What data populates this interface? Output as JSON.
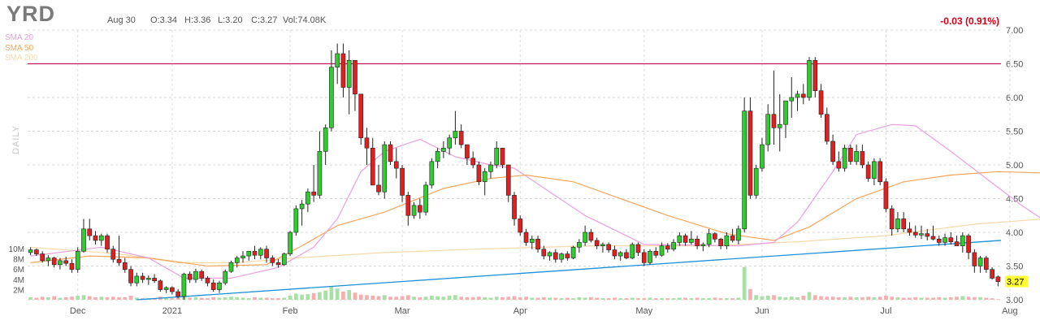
{
  "header": {
    "ticker": "YRD",
    "date": "Aug 30",
    "open": "O:3.34",
    "high": "H:3.36",
    "low": "L:3.20",
    "close": "C:3.27",
    "volume": "Vol:74.08K",
    "change": "-0.03 (0.91%)",
    "panel_label": "DAILY"
  },
  "legend": [
    {
      "name": "SMA 20",
      "color": "#e9a0e0"
    },
    {
      "name": "SMA 50",
      "color": "#f5a55a"
    },
    {
      "name": "SMA 200",
      "color": "#f7d9a8"
    }
  ],
  "colors": {
    "up": "#2ecc2e",
    "down": "#e02020",
    "volume": "#a8e0a8",
    "volume_down": "#f4b0b0",
    "resistance": "#c2185b",
    "trendline": "#1e90d8",
    "last_price_bg": "#ffff33"
  },
  "chart_data": {
    "type": "candlestick",
    "y_ticks": [
      "7.00",
      "6.50",
      "6.00",
      "5.50",
      "5.00",
      "4.50",
      "4.00",
      "3.50",
      "3.00"
    ],
    "ylim": [
      3.0,
      7.0
    ],
    "x_ticks": [
      "Dec",
      "2021",
      "Feb",
      "Mar",
      "Apr",
      "May",
      "Jun",
      "Jul",
      "Aug"
    ],
    "volume_ticks": [
      "10M",
      "8M",
      "6M",
      "4M",
      "2M"
    ],
    "last_price": "3.27",
    "resistance_level": 6.5,
    "trendline": {
      "start": 3.0,
      "end": 3.88
    },
    "ohlc": [
      [
        3.7,
        3.78,
        3.66,
        3.74
      ],
      [
        3.74,
        3.76,
        3.65,
        3.68
      ],
      [
        3.68,
        3.72,
        3.55,
        3.58
      ],
      [
        3.58,
        3.66,
        3.5,
        3.62
      ],
      [
        3.62,
        3.64,
        3.48,
        3.52
      ],
      [
        3.52,
        3.62,
        3.45,
        3.58
      ],
      [
        3.58,
        3.64,
        3.5,
        3.54
      ],
      [
        3.54,
        3.6,
        3.4,
        3.45
      ],
      [
        3.45,
        3.78,
        3.4,
        3.72
      ],
      [
        3.72,
        4.2,
        3.7,
        4.05
      ],
      [
        4.05,
        4.2,
        3.88,
        3.95
      ],
      [
        3.95,
        4.02,
        3.82,
        3.88
      ],
      [
        3.88,
        3.98,
        3.8,
        3.95
      ],
      [
        3.95,
        3.98,
        3.7,
        3.75
      ],
      [
        3.75,
        3.8,
        3.55,
        3.6
      ],
      [
        3.6,
        3.95,
        3.5,
        3.55
      ],
      [
        3.55,
        3.62,
        3.4,
        3.45
      ],
      [
        3.45,
        3.5,
        3.2,
        3.25
      ],
      [
        3.25,
        3.4,
        3.2,
        3.35
      ],
      [
        3.35,
        3.4,
        3.25,
        3.3
      ],
      [
        3.3,
        3.36,
        3.22,
        3.32
      ],
      [
        3.32,
        3.38,
        3.25,
        3.28
      ],
      [
        3.28,
        3.3,
        3.12,
        3.15
      ],
      [
        3.15,
        3.2,
        3.1,
        3.18
      ],
      [
        3.18,
        3.2,
        3.08,
        3.12
      ],
      [
        3.12,
        3.16,
        3.02,
        3.05
      ],
      [
        3.05,
        3.4,
        3.0,
        3.38
      ],
      [
        3.38,
        3.42,
        3.25,
        3.3
      ],
      [
        3.3,
        3.46,
        3.25,
        3.42
      ],
      [
        3.42,
        3.45,
        3.28,
        3.32
      ],
      [
        3.32,
        3.35,
        3.2,
        3.25
      ],
      [
        3.25,
        3.3,
        3.12,
        3.15
      ],
      [
        3.15,
        3.28,
        3.1,
        3.25
      ],
      [
        3.25,
        3.45,
        3.22,
        3.42
      ],
      [
        3.42,
        3.58,
        3.4,
        3.55
      ],
      [
        3.55,
        3.65,
        3.48,
        3.62
      ],
      [
        3.62,
        3.72,
        3.55,
        3.65
      ],
      [
        3.65,
        3.7,
        3.58,
        3.72
      ],
      [
        3.72,
        3.8,
        3.6,
        3.66
      ],
      [
        3.66,
        3.78,
        3.6,
        3.75
      ],
      [
        3.75,
        3.8,
        3.55,
        3.62
      ],
      [
        3.62,
        3.66,
        3.5,
        3.55
      ],
      [
        3.55,
        3.6,
        3.48,
        3.52
      ],
      [
        3.52,
        3.7,
        3.5,
        3.68
      ],
      [
        3.68,
        4.02,
        3.65,
        4.0
      ],
      [
        4.0,
        4.4,
        3.95,
        4.35
      ],
      [
        4.35,
        4.48,
        4.1,
        4.42
      ],
      [
        4.42,
        4.65,
        4.3,
        4.6
      ],
      [
        4.6,
        5.0,
        4.45,
        4.55
      ],
      [
        4.55,
        5.5,
        4.5,
        5.2
      ],
      [
        5.2,
        5.6,
        5.0,
        5.55
      ],
      [
        5.55,
        6.7,
        5.5,
        6.45
      ],
      [
        6.45,
        6.8,
        6.2,
        6.65
      ],
      [
        6.65,
        6.8,
        6.0,
        6.15
      ],
      [
        6.15,
        6.7,
        5.75,
        6.55
      ],
      [
        6.55,
        6.55,
        5.8,
        6.05
      ],
      [
        6.05,
        5.6,
        5.3,
        5.4
      ],
      [
        5.4,
        5.55,
        5.0,
        5.25
      ],
      [
        5.25,
        5.4,
        4.85,
        4.7
      ],
      [
        4.7,
        5.0,
        4.55,
        4.6
      ],
      [
        4.6,
        5.35,
        4.5,
        5.3
      ],
      [
        5.3,
        5.35,
        5.0,
        5.05
      ],
      [
        5.05,
        5.25,
        4.8,
        4.95
      ],
      [
        4.95,
        5.0,
        4.45,
        4.55
      ],
      [
        4.55,
        4.6,
        4.1,
        4.25
      ],
      [
        4.25,
        4.45,
        4.2,
        4.4
      ],
      [
        4.4,
        4.5,
        4.2,
        4.3
      ],
      [
        4.3,
        4.75,
        4.25,
        4.7
      ],
      [
        4.7,
        5.1,
        4.65,
        5.05
      ],
      [
        5.05,
        5.25,
        4.95,
        5.2
      ],
      [
        5.2,
        5.35,
        5.1,
        5.25
      ],
      [
        5.25,
        5.45,
        5.15,
        5.4
      ],
      [
        5.4,
        5.8,
        5.3,
        5.5
      ],
      [
        5.5,
        5.6,
        5.25,
        5.3
      ],
      [
        5.3,
        5.3,
        5.0,
        5.1
      ],
      [
        5.1,
        5.2,
        4.95,
        5.0
      ],
      [
        5.0,
        5.05,
        4.7,
        4.75
      ],
      [
        4.75,
        4.95,
        4.55,
        4.9
      ],
      [
        4.9,
        5.05,
        4.8,
        5.0
      ],
      [
        5.0,
        5.35,
        4.95,
        5.25
      ],
      [
        5.25,
        5.2,
        4.95,
        5.0
      ],
      [
        5.0,
        5.0,
        4.45,
        4.55
      ],
      [
        4.55,
        4.6,
        4.1,
        4.2
      ],
      [
        4.2,
        4.25,
        3.95,
        4.0
      ],
      [
        4.0,
        4.05,
        3.8,
        3.85
      ],
      [
        3.85,
        3.95,
        3.75,
        3.9
      ],
      [
        3.9,
        3.95,
        3.7,
        3.75
      ],
      [
        3.75,
        3.8,
        3.6,
        3.65
      ],
      [
        3.65,
        3.72,
        3.58,
        3.7
      ],
      [
        3.7,
        3.75,
        3.55,
        3.6
      ],
      [
        3.6,
        3.7,
        3.55,
        3.68
      ],
      [
        3.68,
        3.72,
        3.58,
        3.62
      ],
      [
        3.62,
        3.8,
        3.6,
        3.78
      ],
      [
        3.78,
        3.9,
        3.7,
        3.85
      ],
      [
        3.85,
        4.1,
        3.8,
        4.0
      ],
      [
        4.0,
        4.05,
        3.85,
        3.88
      ],
      [
        3.88,
        3.92,
        3.75,
        3.8
      ],
      [
        3.8,
        3.85,
        3.7,
        3.82
      ],
      [
        3.82,
        3.85,
        3.7,
        3.74
      ],
      [
        3.74,
        3.8,
        3.6,
        3.65
      ],
      [
        3.65,
        3.72,
        3.58,
        3.7
      ],
      [
        3.7,
        3.75,
        3.6,
        3.62
      ],
      [
        3.62,
        3.85,
        3.6,
        3.82
      ],
      [
        3.82,
        3.85,
        3.65,
        3.7
      ],
      [
        3.7,
        3.75,
        3.5,
        3.55
      ],
      [
        3.55,
        3.75,
        3.52,
        3.72
      ],
      [
        3.72,
        3.78,
        3.62,
        3.66
      ],
      [
        3.66,
        3.85,
        3.64,
        3.8
      ],
      [
        3.8,
        3.84,
        3.7,
        3.75
      ],
      [
        3.75,
        3.9,
        3.72,
        3.85
      ],
      [
        3.85,
        4.0,
        3.8,
        3.95
      ],
      [
        3.95,
        3.98,
        3.8,
        3.85
      ],
      [
        3.85,
        4.02,
        3.82,
        3.9
      ],
      [
        3.9,
        3.95,
        3.75,
        3.8
      ],
      [
        3.8,
        3.85,
        3.72,
        3.82
      ],
      [
        3.82,
        4.05,
        3.78,
        3.98
      ],
      [
        3.98,
        4.0,
        3.85,
        3.9
      ],
      [
        3.9,
        3.92,
        3.75,
        3.8
      ],
      [
        3.8,
        4.0,
        3.75,
        3.95
      ],
      [
        3.95,
        4.05,
        3.85,
        3.88
      ],
      [
        3.88,
        4.1,
        3.82,
        4.05
      ],
      [
        4.05,
        6.0,
        4.0,
        5.8
      ],
      [
        5.8,
        6.0,
        4.5,
        4.55
      ],
      [
        4.55,
        5.0,
        4.5,
        4.95
      ],
      [
        4.95,
        5.4,
        4.9,
        5.3
      ],
      [
        5.3,
        5.9,
        5.2,
        5.75
      ],
      [
        5.75,
        6.4,
        5.3,
        5.55
      ],
      [
        5.55,
        6.05,
        5.2,
        5.6
      ],
      [
        5.6,
        5.7,
        5.4,
        5.95
      ],
      [
        5.95,
        6.3,
        5.7,
        6.0
      ],
      [
        6.0,
        6.1,
        5.8,
        6.05
      ],
      [
        6.05,
        6.2,
        5.9,
        6.0
      ],
      [
        6.0,
        6.6,
        5.95,
        6.55
      ],
      [
        6.55,
        6.6,
        6.0,
        6.1
      ],
      [
        6.1,
        6.2,
        5.7,
        5.75
      ],
      [
        5.75,
        5.85,
        5.3,
        5.35
      ],
      [
        5.35,
        5.45,
        5.0,
        5.05
      ],
      [
        5.05,
        5.2,
        4.9,
        4.95
      ],
      [
        4.95,
        5.3,
        4.9,
        5.25
      ],
      [
        5.25,
        5.3,
        5.0,
        5.05
      ],
      [
        5.05,
        5.3,
        5.0,
        5.2
      ],
      [
        5.2,
        5.3,
        4.95,
        5.0
      ],
      [
        5.0,
        5.05,
        4.75,
        4.8
      ],
      [
        4.8,
        5.1,
        4.7,
        5.05
      ],
      [
        5.05,
        5.1,
        4.7,
        4.75
      ],
      [
        4.75,
        4.8,
        4.3,
        4.35
      ],
      [
        4.35,
        4.4,
        3.95,
        4.05
      ],
      [
        4.05,
        4.3,
        4.0,
        4.2
      ],
      [
        4.2,
        4.3,
        4.0,
        4.05
      ],
      [
        4.05,
        4.15,
        3.95,
        4.0
      ],
      [
        4.0,
        4.1,
        3.92,
        3.96
      ],
      [
        3.96,
        4.1,
        3.9,
        3.98
      ],
      [
        3.98,
        4.05,
        3.88,
        3.94
      ],
      [
        3.94,
        4.1,
        3.88,
        3.9
      ],
      [
        3.9,
        3.95,
        3.8,
        3.85
      ],
      [
        3.85,
        3.98,
        3.8,
        3.92
      ],
      [
        3.92,
        4.0,
        3.82,
        3.86
      ],
      [
        3.86,
        3.95,
        3.8,
        3.8
      ],
      [
        3.8,
        4.0,
        3.7,
        3.95
      ],
      [
        3.95,
        3.98,
        3.6,
        3.7
      ],
      [
        3.7,
        3.75,
        3.4,
        3.5
      ],
      [
        3.5,
        3.65,
        3.4,
        3.62
      ],
      [
        3.62,
        3.65,
        3.4,
        3.45
      ],
      [
        3.45,
        3.48,
        3.3,
        3.32
      ],
      [
        3.34,
        3.36,
        3.2,
        3.27
      ]
    ],
    "volume_millions": [
      0.5,
      0.4,
      0.6,
      0.5,
      0.7,
      0.4,
      0.5,
      0.6,
      0.8,
      0.9,
      0.7,
      0.5,
      0.6,
      0.5,
      0.6,
      0.5,
      0.5,
      0.8,
      0.4,
      0.3,
      0.3,
      0.3,
      0.6,
      0.4,
      0.3,
      0.7,
      0.6,
      0.4,
      0.5,
      0.4,
      0.3,
      0.5,
      0.4,
      0.5,
      0.6,
      0.5,
      0.4,
      0.3,
      0.5,
      0.4,
      0.4,
      0.3,
      0.3,
      0.4,
      0.8,
      1.2,
      1.0,
      1.1,
      1.3,
      1.5,
      1.8,
      2.6,
      2.2,
      1.6,
      1.9,
      1.4,
      1.0,
      0.9,
      0.8,
      0.7,
      0.9,
      0.6,
      0.6,
      0.7,
      0.9,
      0.6,
      0.5,
      0.6,
      0.8,
      0.7,
      0.6,
      0.8,
      0.9,
      0.6,
      0.5,
      0.5,
      0.6,
      0.5,
      0.4,
      0.6,
      0.5,
      0.6,
      0.7,
      0.5,
      0.6,
      0.4,
      0.4,
      0.5,
      0.4,
      0.4,
      0.3,
      0.4,
      0.3,
      0.5,
      0.4,
      0.5,
      0.4,
      0.3,
      0.3,
      0.4,
      0.3,
      0.3,
      0.4,
      0.3,
      0.3,
      0.4,
      0.3,
      0.3,
      0.3,
      0.3,
      0.4,
      0.4,
      0.3,
      0.4,
      0.3,
      0.3,
      0.4,
      0.3,
      0.3,
      0.3,
      0.4,
      6.4,
      2.1,
      0.9,
      0.7,
      0.8,
      0.9,
      0.6,
      0.5,
      0.6,
      0.5,
      0.8,
      1.5,
      0.9,
      0.7,
      0.6,
      0.6,
      0.5,
      0.5,
      0.6,
      0.5,
      0.5,
      0.6,
      0.5,
      0.6,
      0.8,
      0.6,
      0.5,
      0.4,
      0.4,
      0.5,
      0.4,
      0.4,
      0.4,
      0.5,
      0.4,
      0.5,
      0.6,
      0.7,
      0.6,
      0.5,
      0.5,
      0.4,
      0.3,
      0.1
    ],
    "sma20": [
      [
        0,
        3.65
      ],
      [
        12,
        3.78
      ],
      [
        20,
        3.62
      ],
      [
        26,
        3.32
      ],
      [
        34,
        3.32
      ],
      [
        42,
        3.48
      ],
      [
        48,
        3.78
      ],
      [
        52,
        4.2
      ],
      [
        56,
        4.9
      ],
      [
        60,
        5.2
      ],
      [
        66,
        5.38
      ],
      [
        72,
        5.12
      ],
      [
        78,
        5.0
      ],
      [
        82,
        4.95
      ],
      [
        88,
        4.6
      ],
      [
        94,
        4.25
      ],
      [
        104,
        3.82
      ],
      [
        120,
        3.8
      ],
      [
        126,
        3.85
      ],
      [
        130,
        4.15
      ],
      [
        136,
        4.9
      ],
      [
        140,
        5.45
      ],
      [
        146,
        5.6
      ],
      [
        150,
        5.58
      ],
      [
        156,
        5.2
      ],
      [
        162,
        4.8
      ],
      [
        168,
        4.4
      ],
      [
        174,
        4.05
      ],
      [
        179,
        3.8
      ]
    ],
    "sma50": [
      [
        0,
        3.55
      ],
      [
        10,
        3.65
      ],
      [
        20,
        3.62
      ],
      [
        30,
        3.5
      ],
      [
        40,
        3.52
      ],
      [
        46,
        3.8
      ],
      [
        52,
        4.1
      ],
      [
        60,
        4.3
      ],
      [
        70,
        4.65
      ],
      [
        78,
        4.8
      ],
      [
        84,
        4.85
      ],
      [
        92,
        4.75
      ],
      [
        100,
        4.5
      ],
      [
        108,
        4.25
      ],
      [
        118,
        3.98
      ],
      [
        126,
        3.88
      ],
      [
        132,
        4.08
      ],
      [
        140,
        4.5
      ],
      [
        148,
        4.75
      ],
      [
        156,
        4.85
      ],
      [
        164,
        4.9
      ],
      [
        172,
        4.88
      ],
      [
        179,
        4.55
      ]
    ],
    "sma200": [
      [
        0,
        3.78
      ],
      [
        15,
        3.68
      ],
      [
        25,
        3.55
      ],
      [
        35,
        3.55
      ],
      [
        45,
        3.62
      ],
      [
        60,
        3.7
      ],
      [
        75,
        3.75
      ],
      [
        95,
        3.8
      ],
      [
        115,
        3.8
      ],
      [
        130,
        3.86
      ],
      [
        145,
        3.95
      ],
      [
        160,
        4.12
      ],
      [
        172,
        4.2
      ],
      [
        179,
        4.2
      ]
    ]
  }
}
